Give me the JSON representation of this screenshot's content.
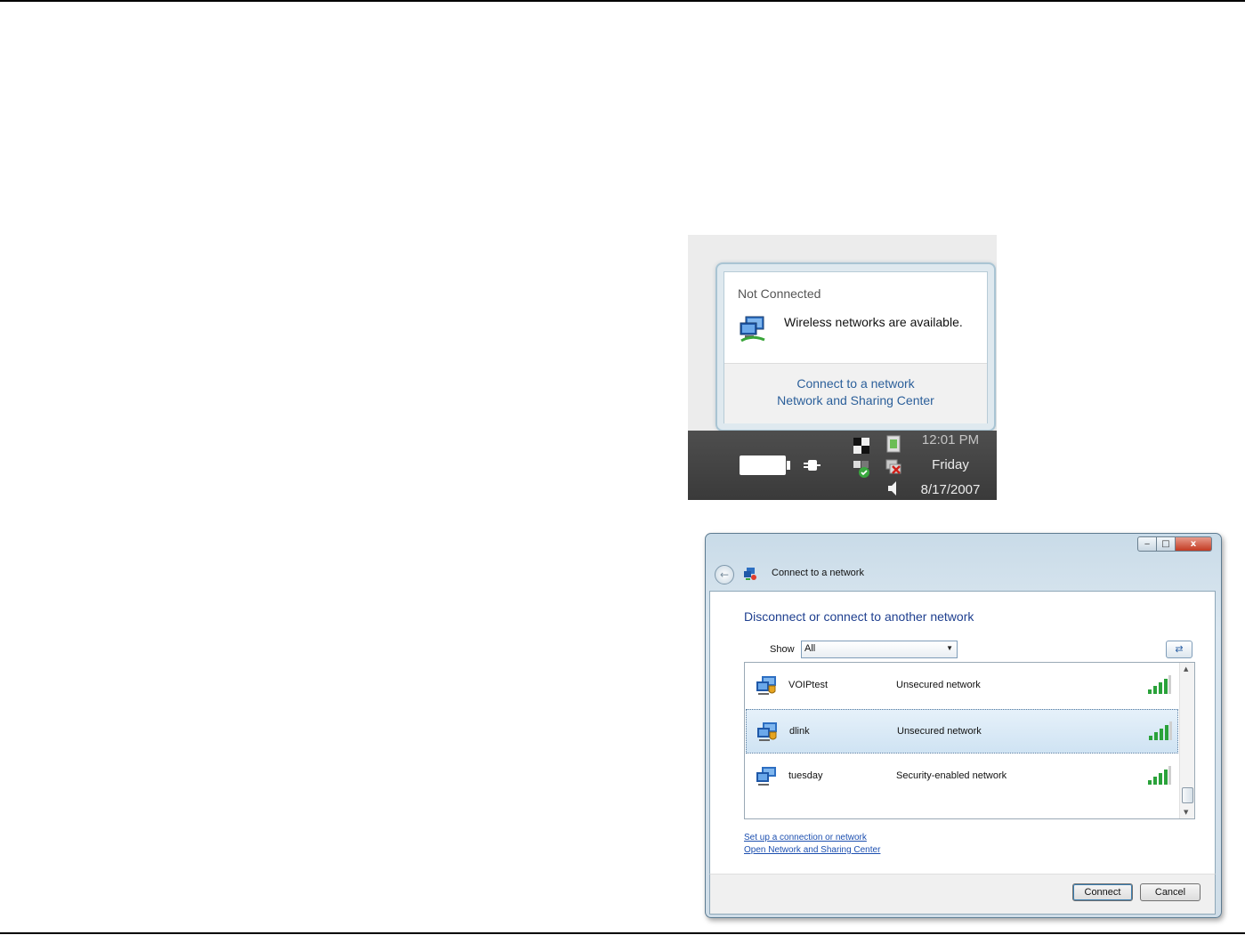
{
  "balloon": {
    "title": "Not Connected",
    "message": "Wireless networks are available.",
    "links": [
      "Connect to a network",
      "Network and Sharing Center"
    ],
    "icon": "wireless-network-icon"
  },
  "taskbar": {
    "time": "12:01 PM",
    "day": "Friday",
    "date": "8/17/2007",
    "icons": [
      "battery-icon",
      "power-plug-icon",
      "security-shield-icon",
      "network-icon",
      "network-disconnected-icon",
      "volume-icon"
    ]
  },
  "window": {
    "address_title": "Connect to a network",
    "heading": "Disconnect or connect to another network",
    "show_label": "Show",
    "show_value": "All",
    "networks": [
      {
        "name": "VOIPtest",
        "security": "Unsecured network",
        "selected": false,
        "signal_bars": 4
      },
      {
        "name": "dlink",
        "security": "Unsecured network",
        "selected": true,
        "signal_bars": 4
      },
      {
        "name": "tuesday",
        "security": "Security-enabled network",
        "selected": false,
        "signal_bars": 4
      }
    ],
    "links": [
      "Set up a connection or network",
      "Open Network and Sharing Center"
    ],
    "buttons": {
      "connect": "Connect",
      "cancel": "Cancel"
    },
    "controls": {
      "minimize": "‒",
      "maximize": "□",
      "close": "x"
    }
  }
}
